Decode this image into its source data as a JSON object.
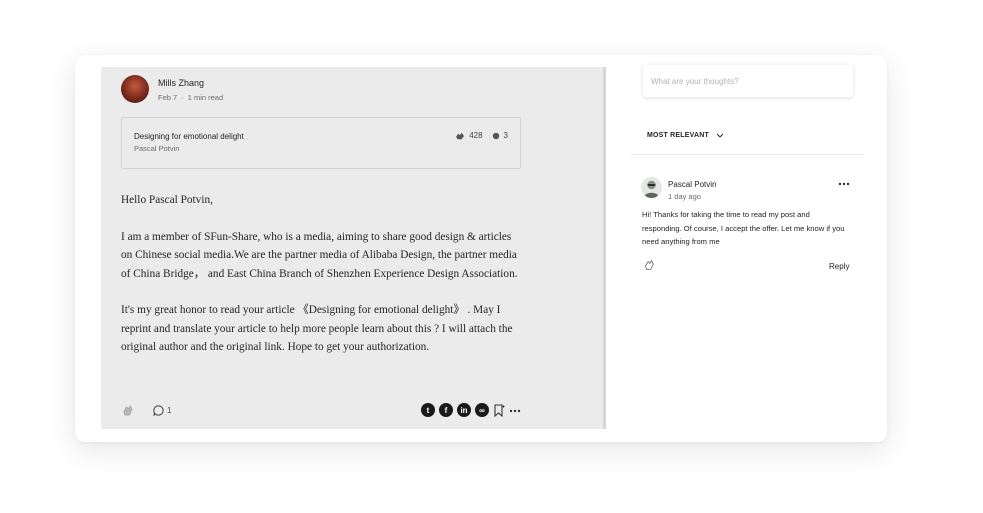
{
  "post": {
    "author": {
      "name": "Mills Zhang",
      "date": "Feb 7",
      "read_time": "1 min read"
    },
    "quote": {
      "title": "Designing for emotional delight",
      "author": "Pascal Potvin",
      "claps": "428",
      "responses": "3"
    },
    "paragraphs": [
      "Hello Pascal Potvin,",
      "I am a member of SFun-Share, who is a media, aiming to share good design & articles on Chinese social media.We are the partner media of Alibaba Design, the partner media of China Bridge，  and East China Branch of Shenzhen Experience Design Association.",
      "It's my great honor to read your article 《Designing for emotional delight》 . May I reprint and translate your article to help more people learn about this ? I will attach the original author and the original link. Hope to get your authorization."
    ],
    "comment_count": "1",
    "share_icons": [
      {
        "name": "twitter-icon",
        "glyph": "t"
      },
      {
        "name": "facebook-icon",
        "glyph": "f"
      },
      {
        "name": "linkedin-icon",
        "glyph": "in"
      },
      {
        "name": "link-icon",
        "glyph": "∞"
      }
    ]
  },
  "responses": {
    "input_placeholder": "What are your thoughts?",
    "sort_label": "MOST RELEVANT",
    "comment": {
      "name": "Pascal Potvin",
      "time": "1 day ago",
      "text": "Hi! Thanks for taking the time to read my post and responding. Of course, I accept the offer. Let me know if you need anything from me",
      "reply_label": "Reply"
    }
  }
}
